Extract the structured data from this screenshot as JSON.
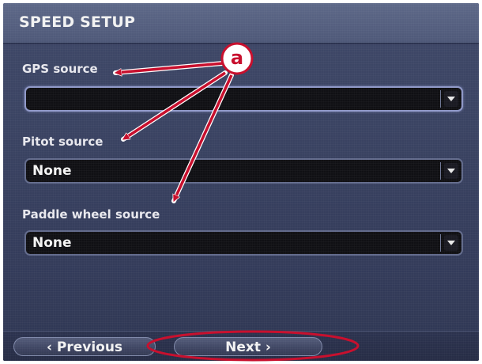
{
  "header": {
    "title": "SPEED SETUP"
  },
  "fields": [
    {
      "label": "GPS source",
      "value": ""
    },
    {
      "label": "Pitot source",
      "value": "None"
    },
    {
      "label": "Paddle wheel source",
      "value": "None"
    }
  ],
  "footer": {
    "previous_label": "‹ Previous",
    "next_label": "Next ›"
  },
  "annotation": {
    "callout_letter": "a",
    "color": "#c8102e"
  },
  "colors": {
    "screen_bg": "#3a4362",
    "dropdown_bg": "#101014",
    "text": "#f2f2f2"
  },
  "icons": {
    "dropdown_arrow": "chevron-down-icon"
  }
}
